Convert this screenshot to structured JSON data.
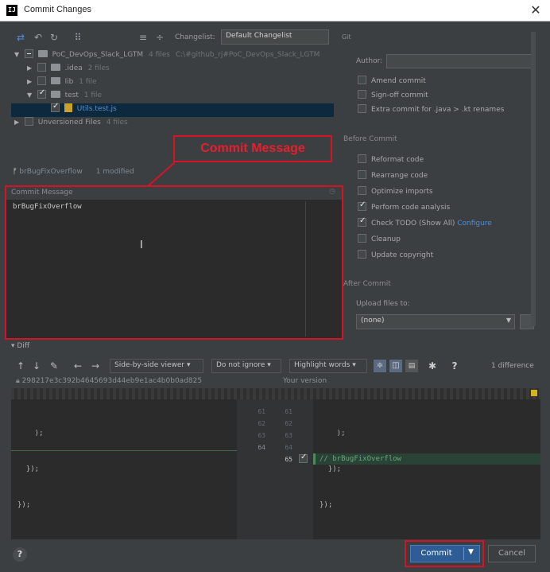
{
  "window": {
    "title": "Commit Changes",
    "app_icon": "IJ",
    "close": "✕"
  },
  "toolbar": {
    "changelist_label": "Changelist:",
    "changelist_value": "Default Changelist",
    "git_label": "Git"
  },
  "tree": {
    "root": {
      "label": "PoC_DevOps_Slack_LGTM",
      "meta": "4 files",
      "path": "C:\\#github_rj#PoC_DevOps_Slack_LGTM"
    },
    "idea": {
      "label": ".idea",
      "meta": "2 files"
    },
    "lib": {
      "label": "lib",
      "meta": "1 file"
    },
    "test": {
      "label": "test",
      "meta": "1 file"
    },
    "file": {
      "label": "Utils.test.js"
    },
    "unversioned": {
      "label": "Unversioned Files",
      "meta": "4 files"
    }
  },
  "branch": {
    "name": "brBugFixOverflow",
    "status": "1 modified"
  },
  "callout": {
    "text": "Commit Message"
  },
  "commit_message": {
    "header": "Commit Message",
    "text": "brBugFixOverflow"
  },
  "git_options": {
    "author_label": "Author:",
    "amend": "Amend commit",
    "signoff": "Sign-off commit",
    "extra": "Extra commit for .java > .kt renames"
  },
  "before_commit": {
    "title": "Before Commit",
    "items": [
      "Reformat code",
      "Rearrange code",
      "Optimize imports",
      "Perform code analysis",
      "Check TODO (Show All)",
      "Cleanup",
      "Update copyright"
    ],
    "configure": "Configure"
  },
  "after_commit": {
    "title": "After Commit",
    "upload_label": "Upload files to:",
    "upload_value": "(none)"
  },
  "diff": {
    "section": "Diff",
    "viewer": "Side-by-side viewer",
    "ignore": "Do not ignore",
    "highlight": "Highlight words",
    "help": "?",
    "differences": "1 difference",
    "hash": "298217e3c392b4645693d44eb9e1ac4b0b0ad825",
    "your_version": "Your version",
    "left_lines": [
      "    );",
      "  });",
      "});"
    ],
    "right_lines": [
      "    );",
      "  });",
      "});"
    ],
    "added_line": "// brBugFixOverflow",
    "left_numbers": [
      "61",
      "62",
      "63",
      "64"
    ],
    "right_numbers": [
      "61",
      "62",
      "63",
      "64",
      "65"
    ]
  },
  "buttons": {
    "commit": "Commit",
    "cancel": "Cancel",
    "help": "?"
  }
}
